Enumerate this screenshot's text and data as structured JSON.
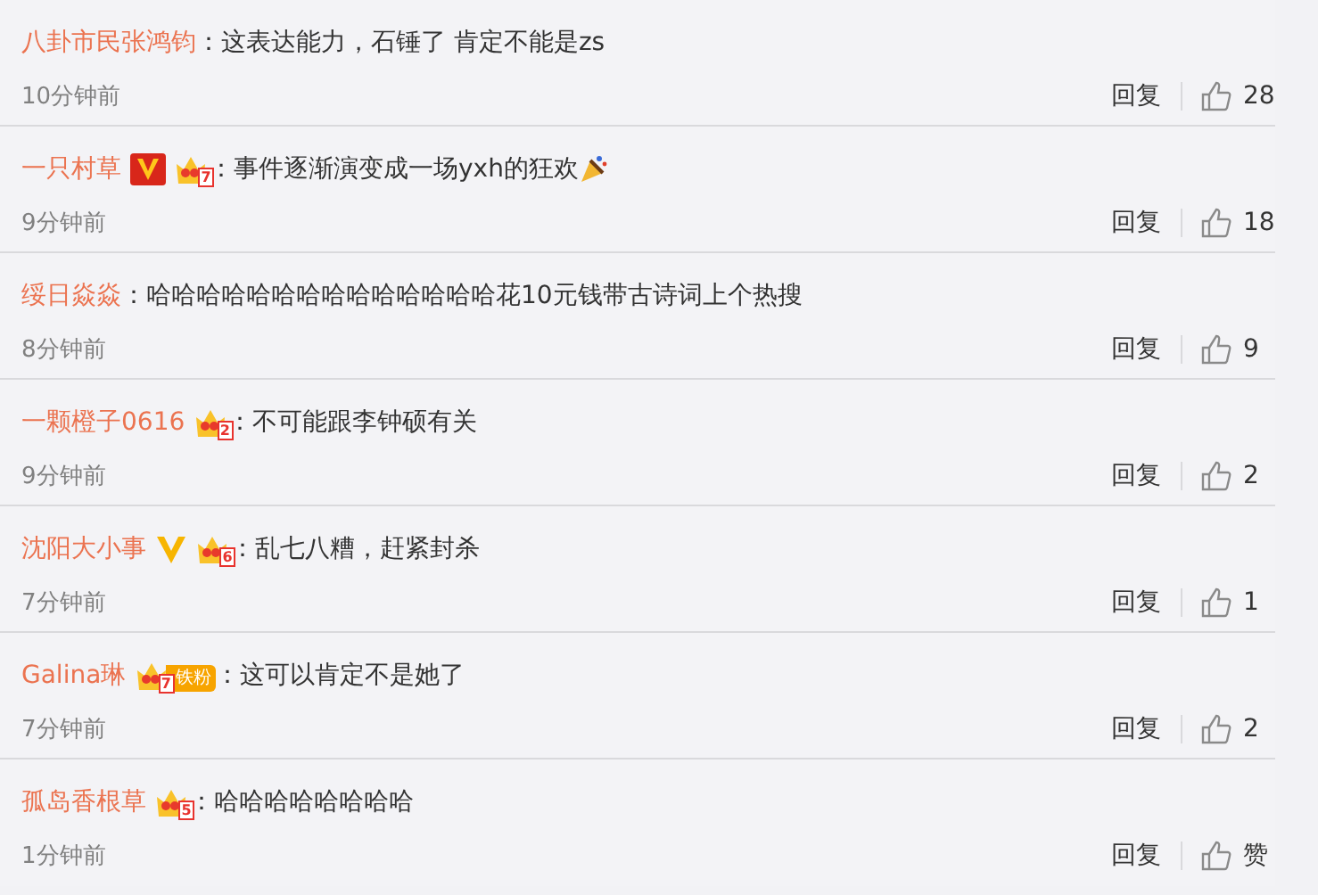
{
  "comments": [
    {
      "user": "八卦市民张鸿钧",
      "text": "：这表达能力，石锤了  肯定不能是zs",
      "emoji": false,
      "time": "10分钟前",
      "reply": "回复",
      "likes": "28"
    },
    {
      "user": "一只村草",
      "badges": [
        {
          "kind": "verified_red"
        },
        {
          "kind": "crown",
          "level": "7"
        }
      ],
      "text": "：事件逐渐演变成一场yxh的狂欢",
      "emoji": true,
      "time": "9分钟前",
      "reply": "回复",
      "likes": "18"
    },
    {
      "user": "绥日焱焱",
      "text": "：哈哈哈哈哈哈哈哈哈哈哈哈哈哈花10元钱带古诗词上个热搜",
      "emoji": false,
      "time": "8分钟前",
      "reply": "回复",
      "likes": "9"
    },
    {
      "user": "一颗橙子0616",
      "badges": [
        {
          "kind": "crown",
          "level": "2"
        }
      ],
      "text": "：不可能跟李钟硕有关",
      "emoji": false,
      "time": "9分钟前",
      "reply": "回复",
      "likes": "2"
    },
    {
      "user": "沈阳大小事",
      "badges": [
        {
          "kind": "verified_gold"
        },
        {
          "kind": "crown",
          "level": "6"
        }
      ],
      "text": "：乱七八糟，赶紧封杀",
      "emoji": false,
      "time": "7分钟前",
      "reply": "回复",
      "likes": "1"
    },
    {
      "user": "Galina琳",
      "badges": [
        {
          "kind": "crown",
          "level": "7",
          "tag": "铁粉"
        }
      ],
      "text": "：这可以肯定不是她了",
      "emoji": false,
      "time": "7分钟前",
      "reply": "回复",
      "likes": "2"
    },
    {
      "user": "孤岛香根草",
      "badges": [
        {
          "kind": "crown",
          "level": "5"
        }
      ],
      "text": "：哈哈哈哈哈哈哈哈",
      "emoji": false,
      "time": "1分钟前",
      "reply": "回复",
      "likes": "赞"
    }
  ]
}
